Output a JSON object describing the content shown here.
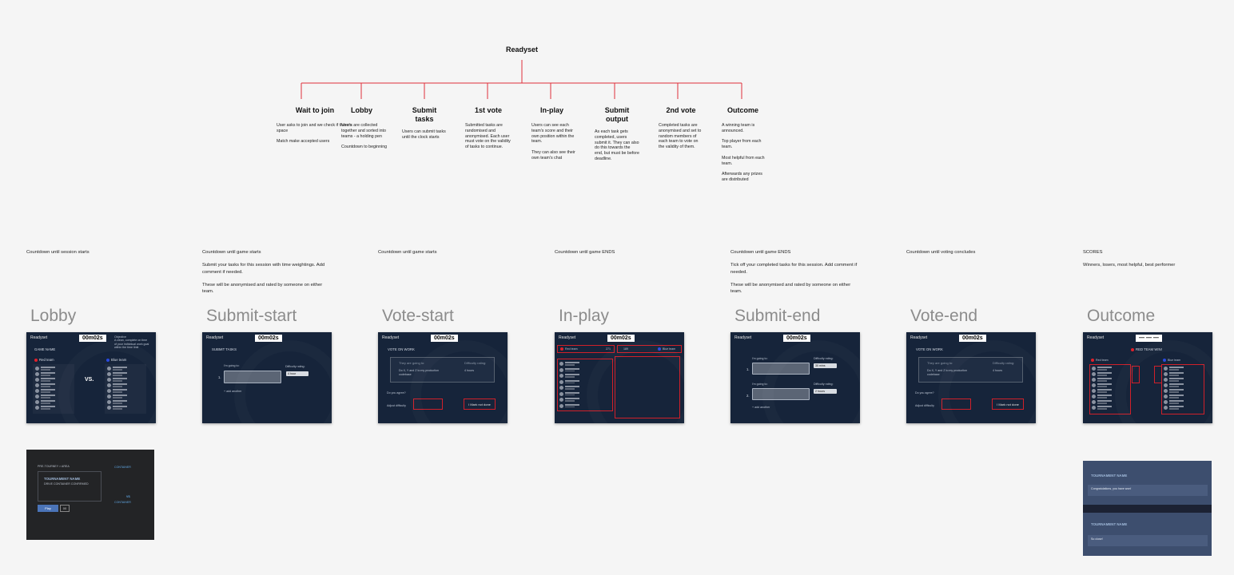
{
  "diagram": {
    "root": "Readyset",
    "stages": [
      {
        "title": "Wait to join",
        "desc": "User asks to join and we check if there's space\n\nMatch make accepted users"
      },
      {
        "title": "Lobby",
        "desc": "Users are collected together and sorted into teams - a holding pen\n\nCountdown to beginning"
      },
      {
        "title": "Submit\ntasks",
        "desc": "Users can submit tasks until the clock starts"
      },
      {
        "title": "1st vote",
        "desc": "Submitted tasks are randomised and anonymised. Each user must vote on the validity of tasks to continue."
      },
      {
        "title": "In-play",
        "desc": "Users can see each team's score and their own position within the team.\n\nThey can also see their own team's chat"
      },
      {
        "title": "Submit\noutput",
        "desc": "As each task gets completed, users submit it. They can also do this towards the end, but must be before deadline."
      },
      {
        "title": "2nd vote",
        "desc": "Completed tasks are anonymised and set to random members of each team to vote on the validity of them."
      },
      {
        "title": "Outcome",
        "desc": "A winning team is announced.\n\nTop player from each team.\n\nMost helpful from each team.\n\nAfterwards any prizes are distributed"
      }
    ],
    "line_color": "#e0303a"
  },
  "columns": [
    {
      "note": "Countdown until session starts",
      "title": "Lobby"
    },
    {
      "note": "Countdown until game starts\n\nSubmit your tasks for this session with time weightings. Add comment if needed.\n\nThese will be anonymised and rated by someone on either team.",
      "title": "Submit-start"
    },
    {
      "note": "Countdown until game starts",
      "title": "Vote-start"
    },
    {
      "note": "Countdown until game ENDS",
      "title": "In-play"
    },
    {
      "note": "Countdown until game ENDS\n\nTick off your completed tasks for this session. Add comment if needed.\n\nThese will be anonymised and rated by someone on either team.",
      "title": "Submit-end"
    },
    {
      "note": "Countdown until voting concludes",
      "title": "Vote-end"
    },
    {
      "note": "SCORES\n\nWinners, losers, most helpful, best performer",
      "title": "Outcome"
    }
  ],
  "screens": {
    "brand": "Readyset",
    "timer": "00m02s",
    "outcome_timer": "— — —",
    "lobby": {
      "game_name": "GAME NAME",
      "objective": "Objective\nA clean, complete on time\nof your individual work goal\nwithin the time limit",
      "red_team": "Red team",
      "blue_team": "Blue team",
      "vs": "VS."
    },
    "submit_start": {
      "heading": "SUBMIT TASKS",
      "going_to": "I'm going to:",
      "difficulty": "Difficulty rating:",
      "num": "1.",
      "select": "4 hour",
      "add": "+ add another"
    },
    "vote_start": {
      "heading": "VOTE ON WORK",
      "going_to": "They are going to:",
      "difficulty": "Difficulty rating:",
      "task": "Do X, Y and Z to my production codebase",
      "hours": "4 hours",
      "agree": "Do you agree?",
      "adjust": "Adjust difficulty",
      "btn": "I Mark not done"
    },
    "in_play": {
      "red_team": "Red team",
      "red_score": "271",
      "blue_score": "189",
      "blue_team": "Blue team"
    },
    "submit_end": {
      "going_to": "I'm going to:",
      "difficulty": "Difficulty rating:",
      "n1": "1.",
      "n2": "2.",
      "sel1": "30 mins",
      "sel2": "2 hours",
      "add": "+ add another"
    },
    "vote_end": {
      "heading": "VOTE ON WORK",
      "going_to": "They are going to:",
      "difficulty": "Difficulty rating:",
      "task": "Do X, Y and Z to my production codebase",
      "hours": "4 hours",
      "agree": "Do you agree?",
      "adjust": "Adjust difficulty",
      "btn": "I Mark not done"
    },
    "outcome": {
      "winner": "RED TEAM WIN!",
      "red_team": "Red team",
      "blue_team": "Blue team"
    }
  },
  "mock_dark": {
    "crumb": "PRE-TOURNEY > AREA",
    "title": "TOURNAMENT NAME",
    "tabs": "DRIVE   CONTAINER   CONFIRMED",
    "play": "Play",
    "vs": "VS",
    "team_a": "CONTAINER",
    "team_b": "CONTAINER"
  },
  "mock_blue": {
    "title1": "TOURNAMENT NAME",
    "congrats": "Congratulations, you have won!",
    "title2": "TOURNAMENT NAME",
    "so_close": "So close!"
  }
}
